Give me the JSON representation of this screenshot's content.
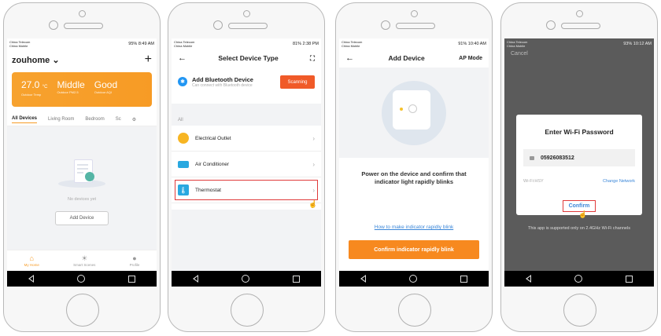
{
  "screen1": {
    "status_carrier": "China Telecom\nChina Mobile",
    "status_right": "95% 8:49 AM",
    "home_title": "zouhome",
    "weather": [
      {
        "value": "27.0",
        "unit": "°C",
        "label": "Outdoor Temp"
      },
      {
        "value": "Middle",
        "unit": "",
        "label": "Outdoor PM2.5"
      },
      {
        "value": "Good",
        "unit": "",
        "label": "Outdoor AQI"
      }
    ],
    "tabs": [
      "All Devices",
      "Living Room",
      "Bedroom",
      "Sc"
    ],
    "empty_text": "No devices yet",
    "add_device": "Add Device",
    "bottom_nav": [
      "My Home",
      "Smart Scenes",
      "Profile"
    ]
  },
  "screen2": {
    "status_carrier": "China Telecom\nChina Mobile",
    "status_right": "81% 2:38 PM",
    "title": "Select Device Type",
    "ble_title": "Add Bluetooth Device",
    "ble_sub": "Can connect with Bluetooth device",
    "scan_label": "Scanning",
    "section": "All",
    "devices": [
      "Electrical Outlet",
      "Air Conditioner",
      "Thermostat"
    ]
  },
  "screen3": {
    "status_carrier": "China Telecom\nChina Mobile",
    "status_right": "91% 10:40 AM",
    "title": "Add Device",
    "ap_mode": "AP Mode",
    "power_text": "Power on the device and confirm that indicator light rapidly blinks",
    "how_link": "How to make indicator rapidly blink",
    "confirm_label": "Confirm indicator rapidly blink"
  },
  "screen4": {
    "status_carrier": "China Telecom\nChina Mobile",
    "status_right": "93% 10:12 AM",
    "cancel": "Cancel",
    "dialog_title": "Enter Wi-Fi Password",
    "password": "05926083512",
    "ssid": "Wi-Fi:HSY",
    "change_network": "Change Network",
    "confirm": "Confirm",
    "note": "This app is supported only on 2.4GHz Wi-Fi channels"
  },
  "colors": {
    "accent_orange": "#f7891f",
    "scan_red": "#f05a28",
    "link_blue": "#3a86d8",
    "highlight_red": "#e03a3a"
  }
}
